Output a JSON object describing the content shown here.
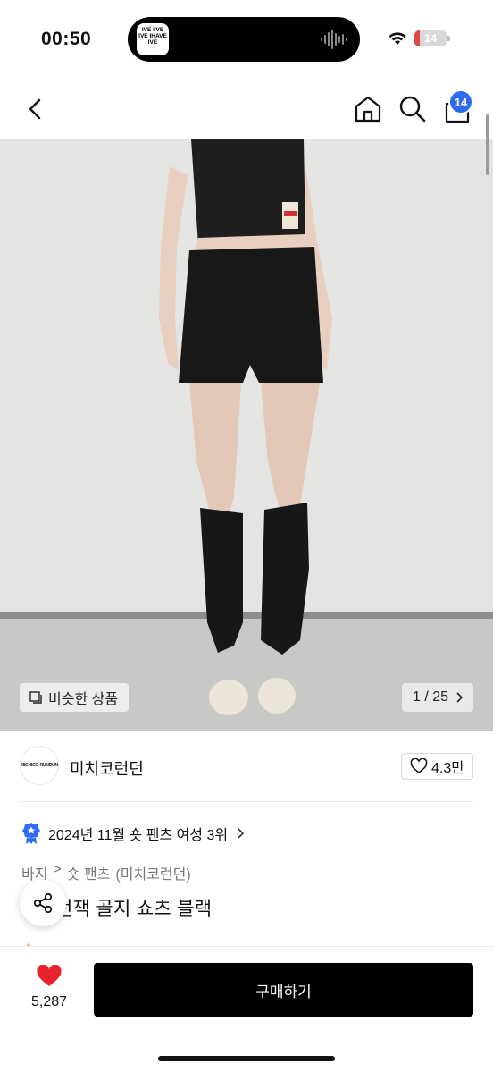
{
  "status_bar": {
    "time": "00:50",
    "island_logo_text": "IVE I'VE IVE IHAVE IVE",
    "battery": "14",
    "battery_level": 0.14,
    "battery_color": "#e04848"
  },
  "header": {
    "cart_count": "14",
    "badge_color": "#2f6bef"
  },
  "gallery": {
    "similar_label": "비슷한 상품",
    "page_indicator": "1 / 25"
  },
  "brand": {
    "logo_text": "MICHICO RUNDUN",
    "name": "미치코런던",
    "likes": "4.3만"
  },
  "ranking": {
    "text": "2024년 11월 숏 팬츠 여성 3위"
  },
  "breadcrumb": [
    "바지",
    ">",
    "숏 팬츠",
    "(미치코런던)"
  ],
  "product": {
    "title": "던잭 골지 쇼츠 블랙"
  },
  "bottom_bar": {
    "wish_count": "5,287",
    "buy_label": "구매하기"
  }
}
